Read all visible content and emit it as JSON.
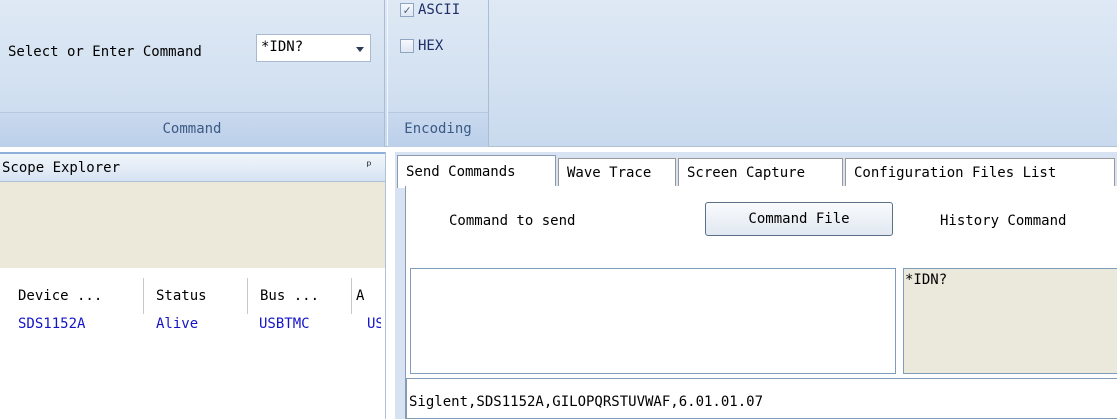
{
  "ribbon": {
    "command_group": {
      "label": "Select or Enter Command",
      "combo_value": "*IDN?",
      "caption": "Command"
    },
    "encoding_group": {
      "ascii_label": "ASCII",
      "ascii_checked": true,
      "hex_label": "HEX",
      "hex_checked": false,
      "caption": "Encoding"
    }
  },
  "explorer": {
    "title": "Scope Explorer",
    "pin_icon": "pin-icon",
    "columns": [
      "Device ...",
      "Status",
      "Bus ...",
      "A"
    ],
    "rows": [
      {
        "device": "SDS1152A",
        "status": "Alive",
        "bus": "USBTMC",
        "addr": "US"
      }
    ]
  },
  "tabs": [
    "Send Commands",
    "Wave Trace",
    "Screen Capture",
    "Configuration Files List"
  ],
  "send_panel": {
    "command_to_send_label": "Command to send",
    "command_file_button": "Command File",
    "history_label": "History Command",
    "send_input_value": "",
    "history_items": [
      "*IDN?"
    ],
    "response": "Siglent,SDS1152A,GILOPQRSTUVWAF,6.01.01.07"
  },
  "colors": {
    "ribbon_bg": "#d3e1f1",
    "caption_text": "#3c5a86",
    "link_blue": "#1414c8",
    "beige": "#ede9da"
  }
}
